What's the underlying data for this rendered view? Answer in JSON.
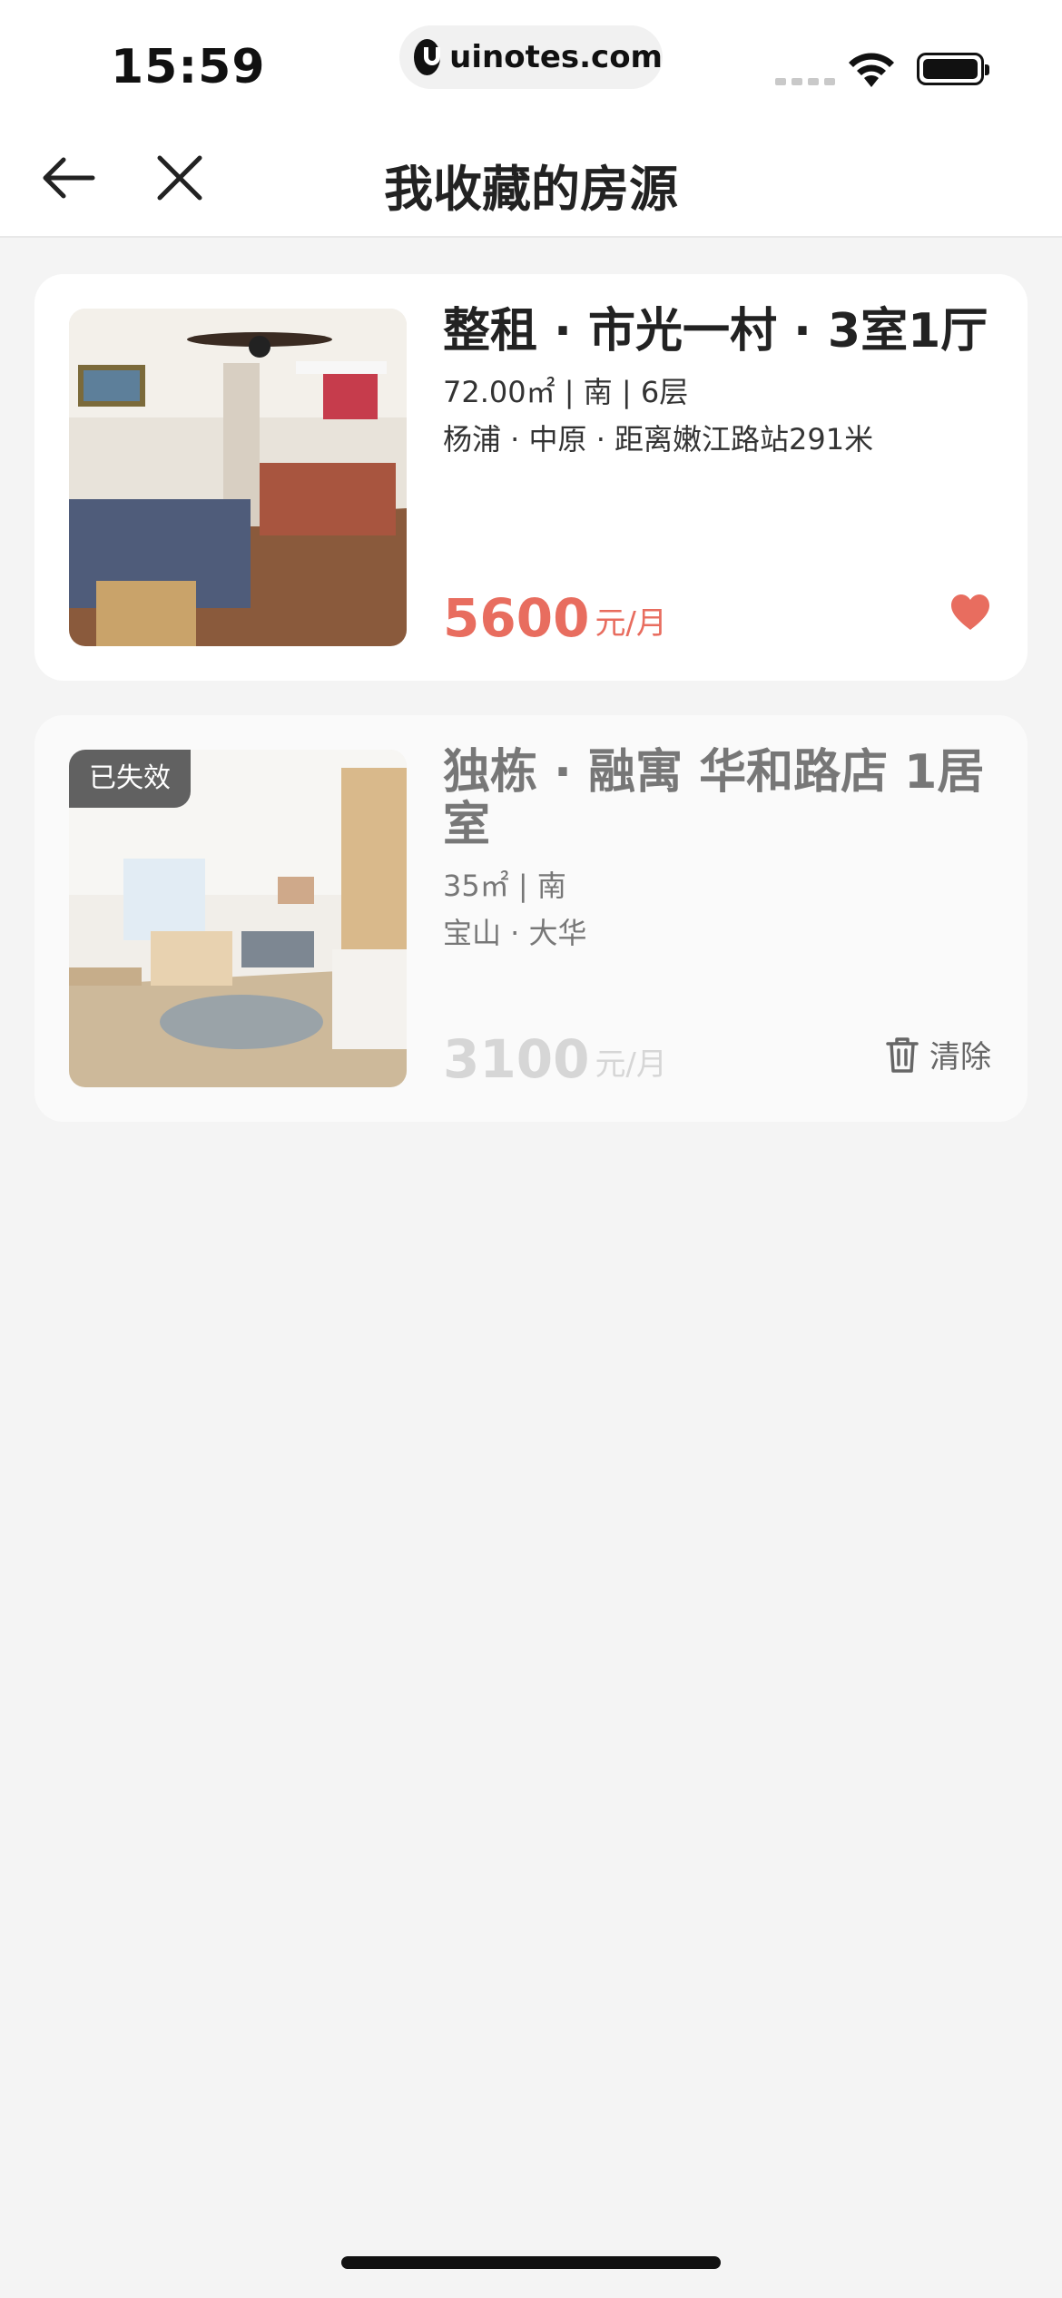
{
  "status_bar": {
    "time": "15:59",
    "url": "uinotes.com"
  },
  "nav": {
    "title": "我收藏的房源",
    "back_icon": "arrow-left-icon",
    "close_icon": "close-icon"
  },
  "colors": {
    "accent_price": "#e86d5f",
    "page_bg": "#f4f4f4"
  },
  "listings": [
    {
      "title": "整租 · 市光一村 · 3室1厅",
      "specs": "72.00㎡ | 南 | 6层",
      "location": "杨浦 · 中原 · 距离嫩江路站291米",
      "price": "5600",
      "price_unit": "元/月",
      "action_icon": "heart-icon",
      "favorited": true
    },
    {
      "badge": "已失效",
      "title": "独栋 · 融寓 华和路店 1居室",
      "specs": "35㎡ | 南",
      "location": "宝山 · 大华",
      "price": "3100",
      "price_unit": "元/月",
      "action_icon": "trash-icon",
      "action_label": "清除"
    }
  ]
}
